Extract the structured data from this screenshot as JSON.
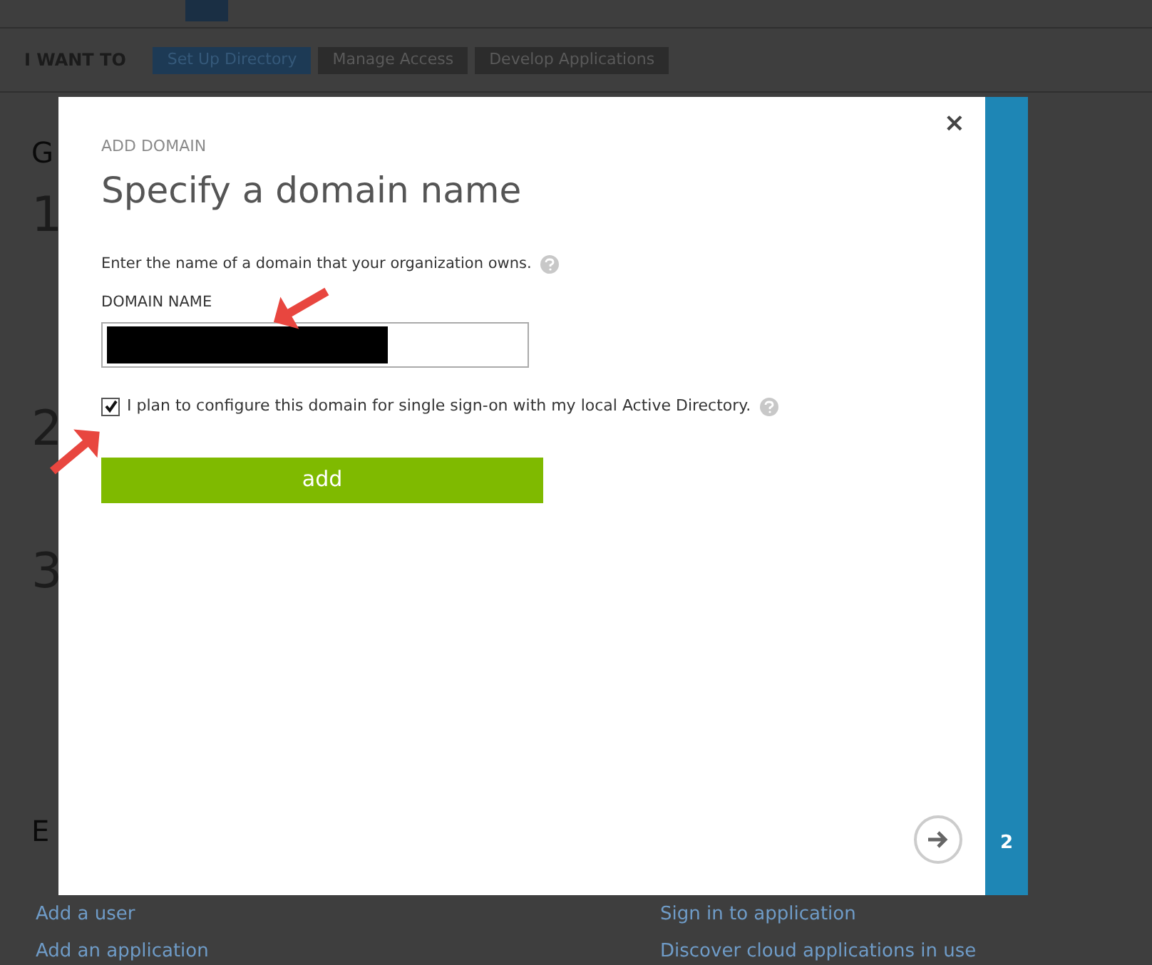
{
  "toolbar": {
    "label": "I WANT TO",
    "tabs": [
      {
        "label": "Set Up Directory",
        "selected": true
      },
      {
        "label": "Manage Access",
        "selected": false
      },
      {
        "label": "Develop Applications",
        "selected": false
      }
    ]
  },
  "background": {
    "heading": "G",
    "steps": [
      "1",
      "2",
      "3"
    ],
    "section_heading": "E",
    "links_left": [
      "Add a user",
      "Add an application"
    ],
    "links_right": [
      "Sign in to application",
      "Discover cloud applications in use"
    ]
  },
  "dialog": {
    "eyebrow": "ADD DOMAIN",
    "title": "Specify a domain name",
    "intro": "Enter the name of a domain that your organization owns.",
    "field_label": "DOMAIN NAME",
    "checkbox": {
      "label": "I plan to configure this domain for single sign-on with my local Active Directory.",
      "checked": true
    },
    "button": "add",
    "close": "×",
    "step": "2"
  }
}
